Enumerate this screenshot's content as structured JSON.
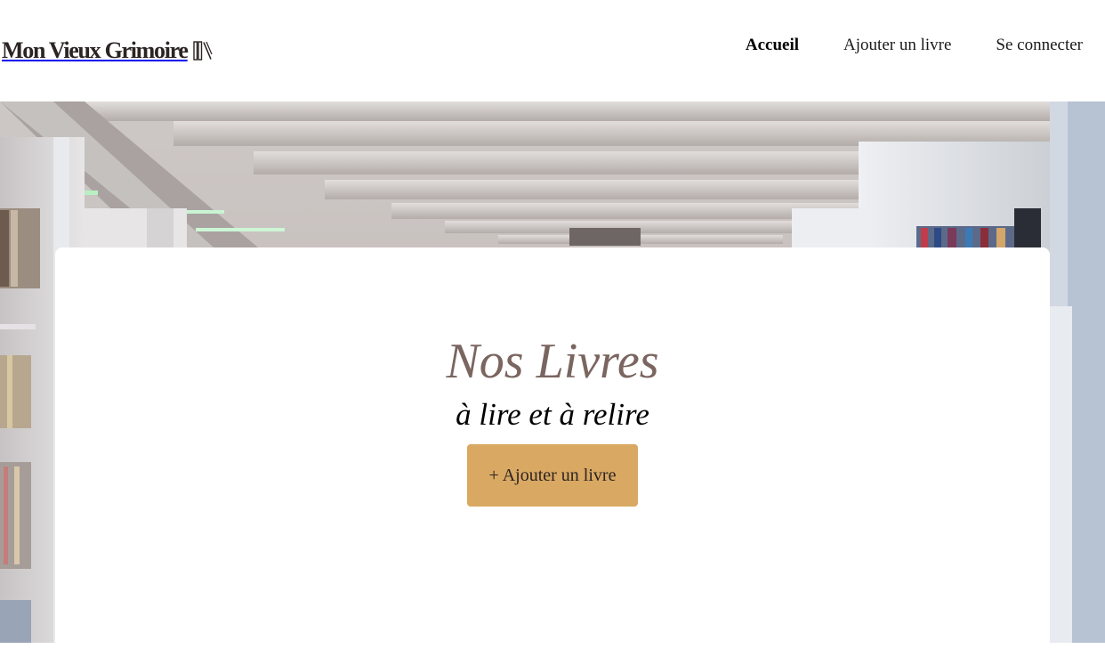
{
  "header": {
    "logo_text": "Mon Vieux Grimoire",
    "logo_icon": "books-icon",
    "nav": [
      {
        "label": "Accueil",
        "active": true
      },
      {
        "label": "Ajouter un livre",
        "active": false
      },
      {
        "label": "Se connecter",
        "active": false
      }
    ]
  },
  "banner": {
    "image": "library-bookshelves-photo"
  },
  "main": {
    "title": "Nos Livres",
    "subtitle": "à lire et à relire",
    "add_button_label": "+ Ajouter un livre"
  },
  "colors": {
    "title": "#7a6560",
    "button": "#d9a862",
    "text": "#2b2422"
  }
}
